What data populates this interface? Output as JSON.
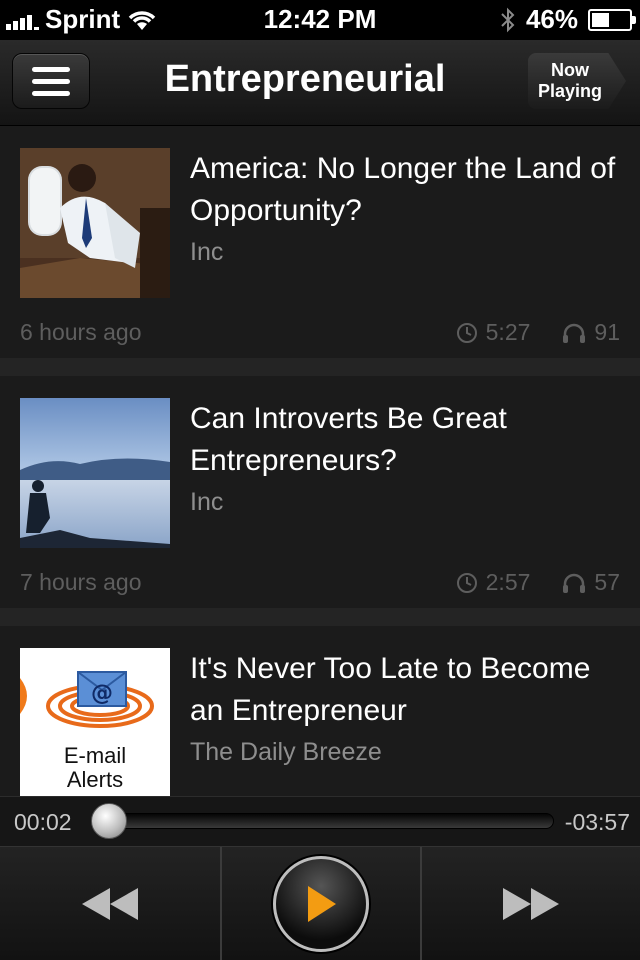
{
  "status_bar": {
    "carrier": "Sprint",
    "time": "12:42 PM",
    "battery_percent": "46%",
    "battery_level": 0.46
  },
  "nav": {
    "title": "Entrepreneurial",
    "now_playing_label_line1": "Now",
    "now_playing_label_line2": "Playing"
  },
  "feed": {
    "items": [
      {
        "title": "America: No Longer the Land of Opportunity?",
        "source": "Inc",
        "age": "6 hours ago",
        "duration": "5:27",
        "listens": "91",
        "thumbnail": "man-at-window-photo"
      },
      {
        "title": "Can Introverts Be Great Entrepreneurs?",
        "source": "Inc",
        "age": "7 hours ago",
        "duration": "2:57",
        "listens": "57",
        "thumbnail": "lake-silhouette-photo"
      },
      {
        "title": "It's Never Too Late to Become an Entrepreneur",
        "source": "The Daily Breeze",
        "age": "",
        "duration": "",
        "listens": "",
        "thumbnail": "email-alerts-graphic",
        "thumb_text_line1": "E-mail",
        "thumb_text_line2": "Alerts"
      }
    ]
  },
  "player": {
    "elapsed": "00:02",
    "remaining": "-03:57",
    "progress_fraction": 0.01
  },
  "colors": {
    "accent_play": "#f39c12",
    "background": "#1b1b1b",
    "muted_text": "#5e5e5e"
  }
}
